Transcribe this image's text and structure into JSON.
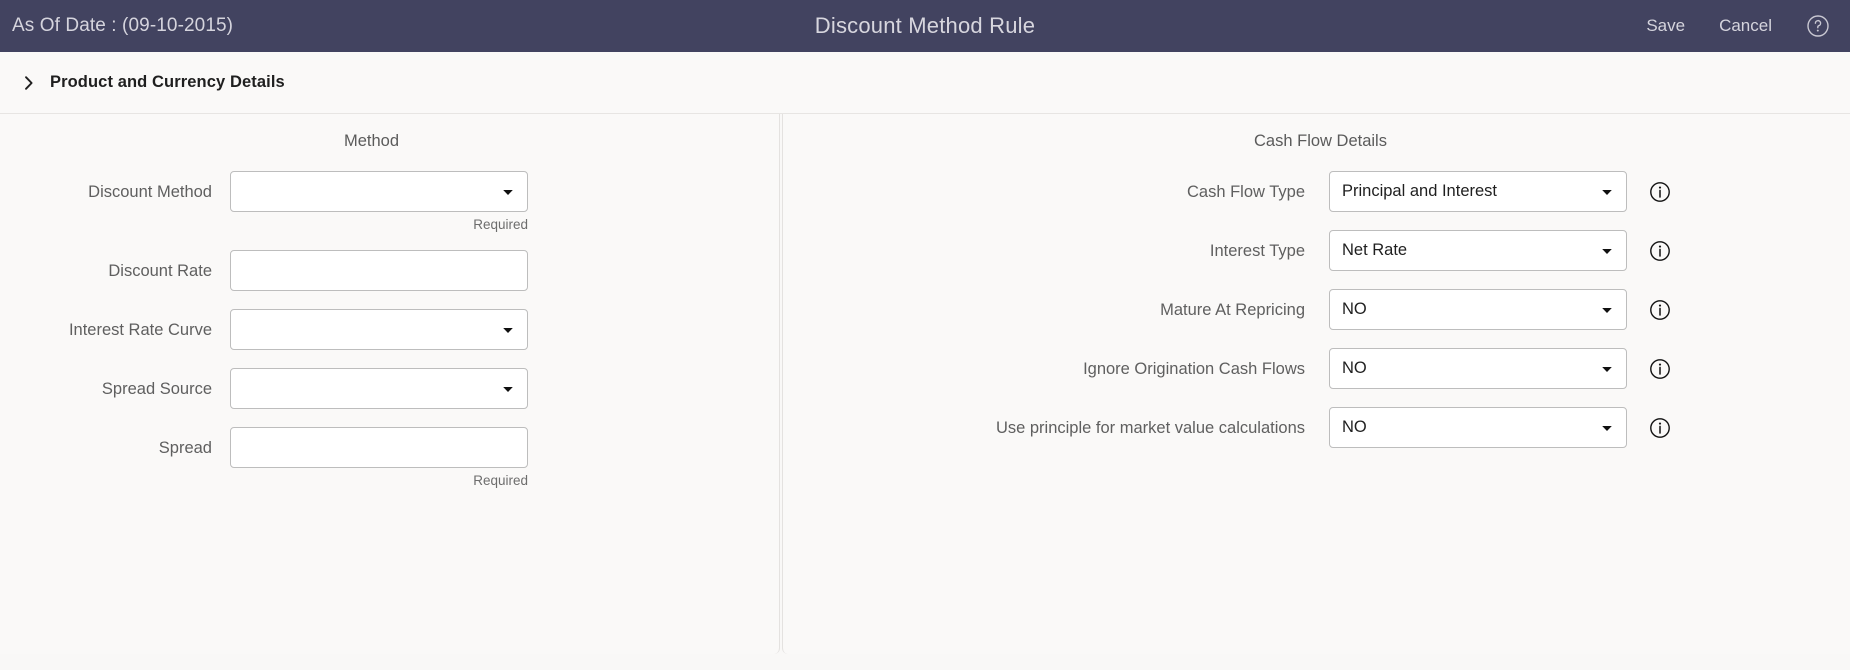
{
  "header": {
    "as_of_date_label": "As Of Date : (09-10-2015)",
    "title": "Discount Method Rule",
    "save_label": "Save",
    "cancel_label": "Cancel",
    "help_icon": "help-circle-icon"
  },
  "accordion": {
    "title": "Product and Currency Details",
    "toggle_icon": "chevron-right-icon",
    "expanded": false
  },
  "method_panel": {
    "heading": "Method",
    "fields": [
      {
        "label": "Discount Method",
        "type": "select",
        "value": "",
        "note": "Required",
        "icon": "caret-down-icon"
      },
      {
        "label": "Discount Rate",
        "type": "text",
        "value": "",
        "note": "",
        "icon": ""
      },
      {
        "label": "Interest Rate Curve",
        "type": "select",
        "value": "",
        "note": "",
        "icon": "caret-down-icon"
      },
      {
        "label": "Spread Source",
        "type": "select",
        "value": "",
        "note": "",
        "icon": "caret-down-icon"
      },
      {
        "label": "Spread",
        "type": "text",
        "value": "",
        "note": "Required",
        "icon": ""
      }
    ]
  },
  "cash_flow_panel": {
    "heading": "Cash Flow Details",
    "fields": [
      {
        "label": "Cash Flow Type",
        "type": "select",
        "value": "Principal and Interest",
        "icon": "caret-down-icon",
        "info_icon": "info-circle-icon"
      },
      {
        "label": "Interest Type",
        "type": "select",
        "value": "Net Rate",
        "icon": "caret-down-icon",
        "info_icon": "info-circle-icon"
      },
      {
        "label": "Mature At Repricing",
        "type": "select",
        "value": "NO",
        "icon": "caret-down-icon",
        "info_icon": "info-circle-icon"
      },
      {
        "label": "Ignore Origination Cash Flows",
        "type": "select",
        "value": "NO",
        "icon": "caret-down-icon",
        "info_icon": "info-circle-icon"
      },
      {
        "label": "Use principle for market value calculations",
        "type": "select",
        "value": "NO",
        "icon": "caret-down-icon",
        "info_icon": "info-circle-icon"
      }
    ]
  },
  "colors": {
    "header_background": "#424360",
    "header_text": "#d5d4dd",
    "page_background": "#f9f8f7",
    "panel_background": "#faf9f8",
    "control_border": "#bdbdbd",
    "label_text": "#5f5f5f"
  }
}
